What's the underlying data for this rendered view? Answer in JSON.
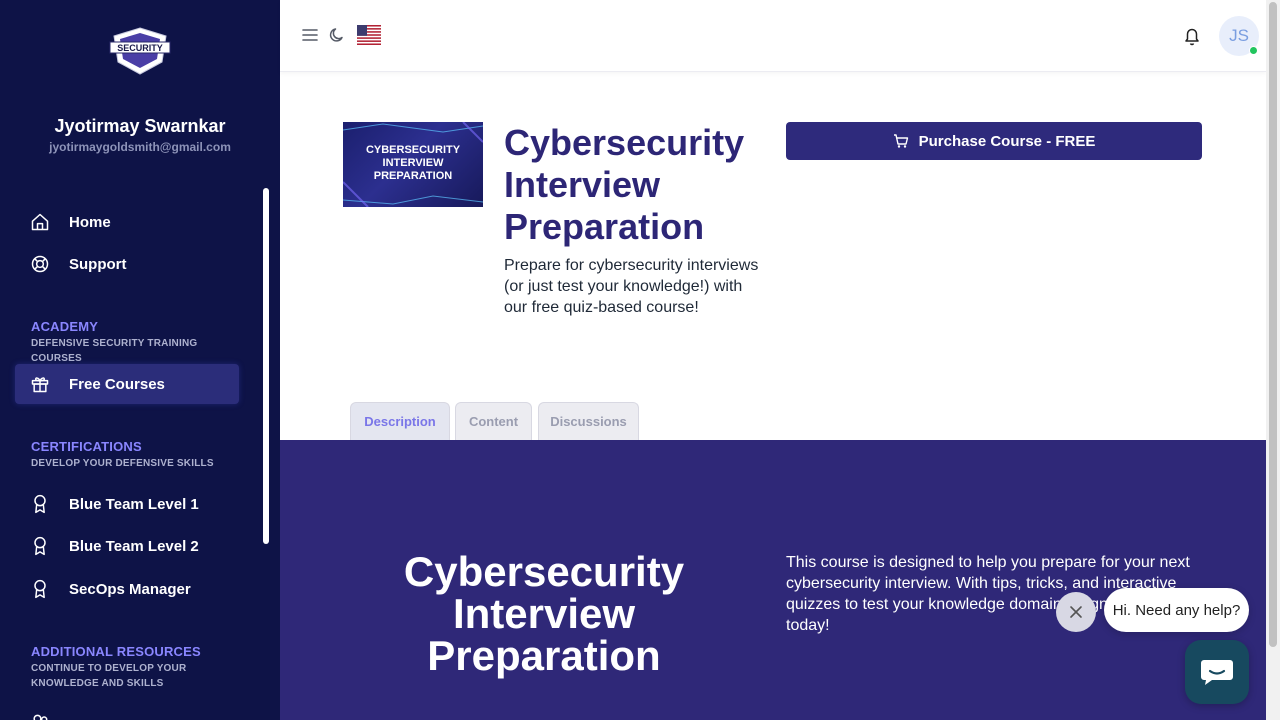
{
  "sidebar": {
    "logo_text": "SECURITY",
    "user_name": "Jyotirmay Swarnkar",
    "user_email": "jyotirmaygoldsmith@gmail.com",
    "main_nav": [
      {
        "label": "Home",
        "icon": "home-icon"
      },
      {
        "label": "Support",
        "icon": "lifebuoy-icon"
      }
    ],
    "academy": {
      "title": "ACADEMY",
      "subtitle": "DEFENSIVE SECURITY TRAINING COURSES",
      "items": [
        {
          "label": "Free Courses",
          "icon": "gift-icon",
          "active": true
        }
      ]
    },
    "certifications": {
      "title": "CERTIFICATIONS",
      "subtitle": "DEVELOP YOUR DEFENSIVE SKILLS",
      "items": [
        {
          "label": "Blue Team Level 1",
          "icon": "award-icon"
        },
        {
          "label": "Blue Team Level 2",
          "icon": "award-icon"
        },
        {
          "label": "SecOps Manager",
          "icon": "award-icon"
        }
      ]
    },
    "additional": {
      "title": "ADDITIONAL RESOURCES",
      "subtitle": "CONTINUE TO DEVELOP YOUR KNOWLEDGE AND SKILLS"
    }
  },
  "topbar": {
    "menu_icon": "hamburger-icon",
    "theme_icon": "moon-icon",
    "flag_icon": "us-flag-icon",
    "bell_icon": "bell-icon",
    "avatar_initials": "JS"
  },
  "course": {
    "thumbnail_text": "CYBERSECURITY INTERVIEW PREPARATION",
    "title": "Cybersecurity Interview Preparation",
    "description": "Prepare for cybersecurity interviews (or just test your knowledge!) with our free quiz-based course!",
    "purchase_label": "Purchase Course - FREE"
  },
  "tabs": [
    {
      "label": "Description",
      "active": true
    },
    {
      "label": "Content",
      "active": false
    },
    {
      "label": "Discussions",
      "active": false
    }
  ],
  "hero": {
    "title": "Cybersecurity Interview Preparation",
    "text": "This course is designed to help you prepare for your next cybersecurity interview. With tips, tricks, and interactive quizzes to test your knowledge domains, sign up for free today!"
  },
  "chat": {
    "greeting": "Hi. Need any help?"
  },
  "colors": {
    "sidebar_bg": "#0e1347",
    "primary": "#2e2a7c",
    "accent": "#8a86ff",
    "online": "#22c55e"
  }
}
